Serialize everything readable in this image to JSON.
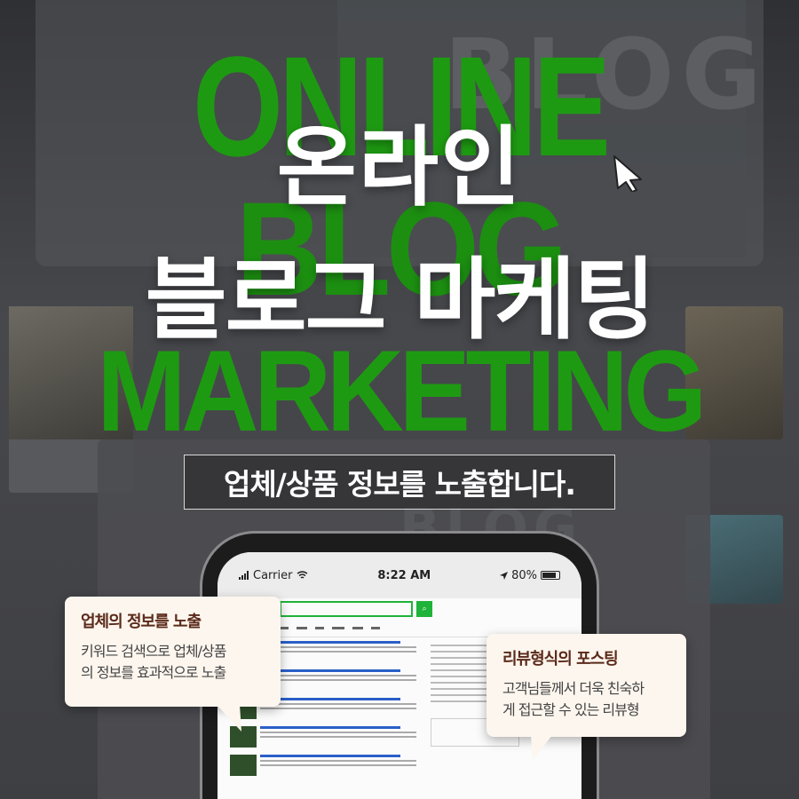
{
  "background": {
    "watermark_top": "BLOG",
    "watermark_mid": "BLOG"
  },
  "headline": {
    "english_1": "ONLINE",
    "english_2": "BLOG",
    "english_3": "MARKETING",
    "korean_1": "온라인",
    "korean_2": "블로그 마케팅",
    "accent_color": "#1e9a12"
  },
  "subtitle": "업체/상품 정보를 노출합니다.",
  "phone": {
    "carrier": "Carrier",
    "time": "8:22 AM",
    "battery": "80%"
  },
  "bubbles": [
    {
      "title": "업체의 정보를 노출",
      "line1": "키워드 검색으로 업체/상품",
      "line2": "의 정보를 효과적으로 노출"
    },
    {
      "title": "리뷰형식의 포스팅",
      "line1": "고객님들께서 더욱 친숙하",
      "line2": "게 접근할 수 있는 리뷰형"
    }
  ],
  "icons": [
    "cursor-arrow-icon",
    "signal-bars-icon",
    "wifi-icon",
    "location-arrow-icon",
    "battery-icon",
    "search-icon"
  ]
}
